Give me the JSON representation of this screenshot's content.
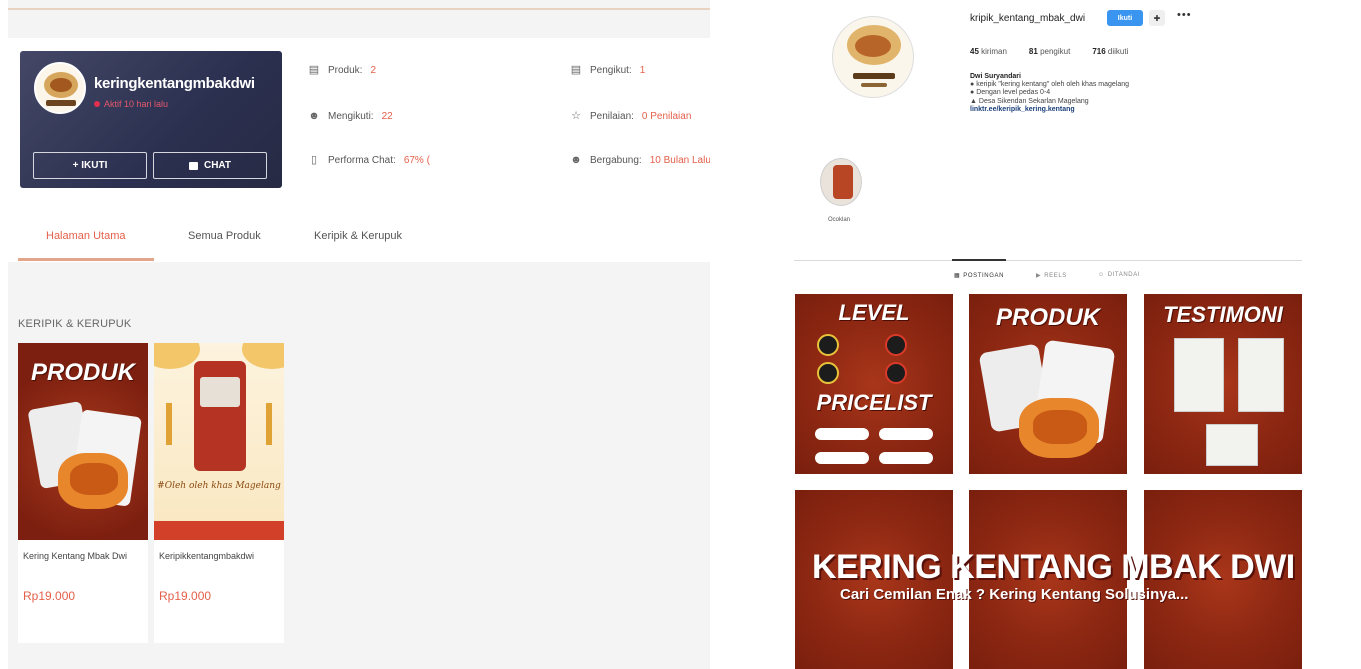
{
  "shop": {
    "name": "keringkentangmbakdwi",
    "status": "Aktif 10 hari lalu",
    "follow_label": "+ IKUTI",
    "chat_label": "CHAT",
    "stats": {
      "produk_label": "Produk:",
      "produk_value": "2",
      "mengikuti_label": "Mengikuti:",
      "mengikuti_value": "22",
      "performa_label": "Performa Chat:",
      "performa_value": "67% (",
      "pengikut_label": "Pengikut:",
      "pengikut_value": "1",
      "penilaian_label": "Penilaian:",
      "penilaian_value": "0 Penilaian",
      "bergabung_label": "Bergabung:",
      "bergabung_value": "10 Bulan Lalu"
    },
    "tabs": [
      "Halaman Utama",
      "Semua Produk",
      "Keripik & Kerupuk"
    ],
    "active_tab": "Halaman Utama",
    "section_title": "KERIPIK & KERUPUK",
    "products": [
      {
        "image_text": "PRODUK",
        "name": "Kering Kentang Mbak Dwi",
        "price": "Rp19.000"
      },
      {
        "image_text": "#Oleh oleh khas Magelang",
        "name": "Keripikkentangmbakdwi",
        "price": "Rp19.000"
      }
    ]
  },
  "instagram": {
    "avatar_text": "Dua Jilid Mbak Dwi",
    "username": "kripik_kentang_mbak_dwi",
    "follow_label": "Ikuti",
    "counts": {
      "posts": "45",
      "posts_label": "kiriman",
      "followers": "81",
      "followers_label": "pengikut",
      "following": "716",
      "following_label": "diikuti"
    },
    "bio": {
      "name": "Dwi Suryandari",
      "line1": "keripik \"kering kentang\" oleh oleh khas magelang",
      "line2": "Dengan level pedas 0-4",
      "line3": "Desa Sikendan Sekarlan Magelang",
      "link": "linktr.ee/keripik_kering.kentang"
    },
    "highlight_label": "Ocoklan",
    "tabs": [
      "POSTINGAN",
      "REELS",
      "DITANDAI"
    ],
    "active_tab": "POSTINGAN",
    "posts": [
      {
        "title": "LEVEL",
        "subtitle": "PRICELIST"
      },
      {
        "title": "PRODUK"
      },
      {
        "title": "TESTIMONI"
      }
    ],
    "banner": {
      "title": "KERING KENTANG MBAK DWI",
      "subtitle": "Cari Cemilan Enak ? Kering Kentang Solusinya..."
    }
  },
  "colors": {
    "accent": "#e4604a",
    "shop_card": "#2c3050",
    "ig_blue": "#3a95f0",
    "post_red": "#8c2712"
  }
}
